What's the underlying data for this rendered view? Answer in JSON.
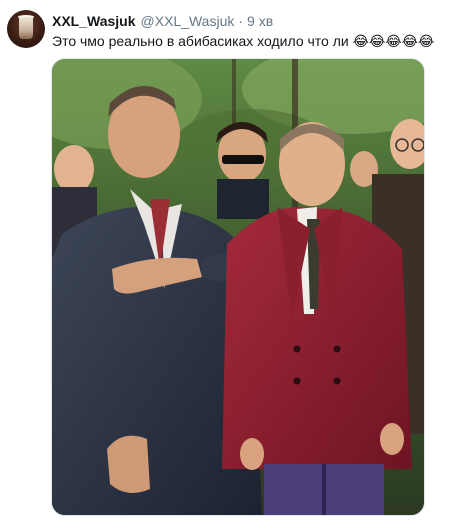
{
  "tweet": {
    "display_name": "XXL_Wasjuk",
    "handle": "@XXL_Wasjuk",
    "separator": "·",
    "time": "9 хв",
    "text": "Это чмо реально в абибасиках ходило что ли",
    "emojis": "😂😂😂😂😂",
    "avatar_icon": "coffee-cup-avatar"
  },
  "media": {
    "type": "photo"
  },
  "colors": {
    "text_primary": "#14171a",
    "text_secondary": "#657786",
    "border": "#e1e8ed",
    "background": "#ffffff"
  }
}
